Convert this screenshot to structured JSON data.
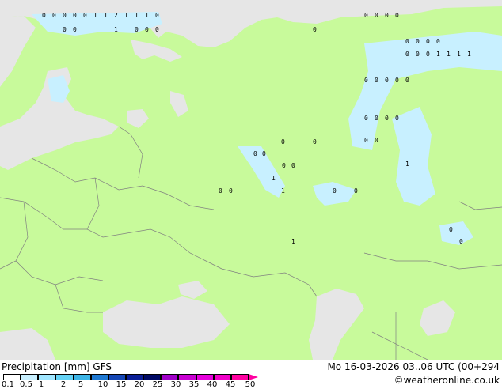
{
  "legend": {
    "title": "Precipitation [mm]",
    "model": "GFS",
    "timestamp": "Mo 16-03-2026 03..06 UTC (00+294",
    "credit": "©weatheronline.co.uk",
    "ticks": [
      "0.1",
      "0.5",
      "1",
      "2",
      "5",
      "10",
      "15",
      "20",
      "25",
      "30",
      "35",
      "40",
      "45",
      "50"
    ],
    "colors": [
      "#ffffff",
      "#c8f0ff",
      "#a0e6ff",
      "#64d2f5",
      "#3cb4e6",
      "#1e78d2",
      "#1446b4",
      "#0a1e96",
      "#000a64",
      "#a000c8",
      "#c800d2",
      "#e600dc",
      "#f000c8",
      "#ff00a0"
    ]
  },
  "map_colors": {
    "land": "#c8fa9b",
    "sea": "#e6e6e6",
    "precip_light": "#c8f0ff",
    "precip_mid": "#a0e6ff",
    "border": "#808080"
  },
  "markers": [
    {
      "v": "0"
    },
    {
      "v": "0"
    },
    {
      "v": "0"
    },
    {
      "v": "0"
    },
    {
      "v": "0"
    },
    {
      "v": "1"
    },
    {
      "v": "1"
    },
    {
      "v": "2"
    },
    {
      "v": "1"
    },
    {
      "v": "1"
    },
    {
      "v": "1"
    },
    {
      "v": "0"
    },
    {
      "v": "0"
    },
    {
      "v": "0"
    },
    {
      "v": "1"
    },
    {
      "v": "0"
    },
    {
      "v": "0"
    },
    {
      "v": "0"
    },
    {
      "v": "0"
    },
    {
      "v": "0"
    },
    {
      "v": "0"
    },
    {
      "v": "0"
    },
    {
      "v": "0"
    },
    {
      "v": "0"
    },
    {
      "v": "0"
    },
    {
      "v": "0"
    },
    {
      "v": "0"
    },
    {
      "v": "0"
    },
    {
      "v": "0"
    },
    {
      "v": "0"
    },
    {
      "v": "0"
    },
    {
      "v": "0"
    },
    {
      "v": "0"
    },
    {
      "v": "0"
    },
    {
      "v": "0"
    },
    {
      "v": "0"
    },
    {
      "v": "0"
    },
    {
      "v": "0"
    },
    {
      "v": "0"
    },
    {
      "v": "0"
    },
    {
      "v": "0"
    },
    {
      "v": "0"
    },
    {
      "v": "0"
    },
    {
      "v": "0"
    },
    {
      "v": "1"
    },
    {
      "v": "1"
    },
    {
      "v": "0"
    },
    {
      "v": "0"
    },
    {
      "v": "0"
    },
    {
      "v": "0"
    },
    {
      "v": "0"
    },
    {
      "v": "1"
    },
    {
      "v": "1"
    },
    {
      "v": "1"
    },
    {
      "v": "1"
    },
    {
      "v": "1"
    },
    {
      "v": "0"
    },
    {
      "v": "0"
    },
    {
      "v": "0"
    },
    {
      "v": "0"
    },
    {
      "v": "1"
    }
  ]
}
